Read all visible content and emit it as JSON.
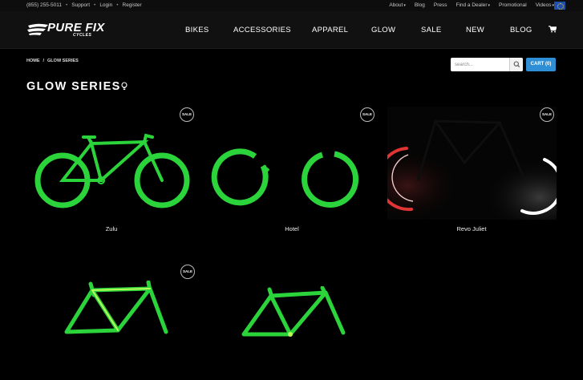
{
  "topbar": {
    "phone": "(855) 255-5011",
    "links": [
      "Support",
      "Login",
      "Register"
    ],
    "right_links": [
      {
        "label": "About",
        "dropdown": true
      },
      {
        "label": "Blog",
        "dropdown": false
      },
      {
        "label": "Press",
        "dropdown": false
      },
      {
        "label": "Find a Dealer",
        "dropdown": true
      },
      {
        "label": "Promotional",
        "dropdown": false
      },
      {
        "label": "Videos",
        "dropdown": true
      }
    ],
    "separator": "•",
    "caret": "▾"
  },
  "header": {
    "logo_text": "PURE FIX",
    "logo_sub": "CYCLES",
    "nav": [
      "BIKES",
      "ACCESSORIES",
      "APPAREL",
      "GLOW",
      "SALE",
      "NEW",
      "BLOG"
    ],
    "cart_icon": "cart-icon"
  },
  "breadcrumb": {
    "items": [
      "HOME",
      "GLOW SERIES"
    ],
    "separator": "/"
  },
  "search": {
    "placeholder": "search..."
  },
  "cart_button": "CART (0)",
  "page": {
    "title": "GLOW SERIES"
  },
  "colors": {
    "glow": "#2bd43a",
    "accent": "#2e8fd6",
    "background": "#000000"
  },
  "products": [
    {
      "name": "Zulu",
      "badge": "SALE"
    },
    {
      "name": "Hotel",
      "badge": "SALE"
    },
    {
      "name": "Revo Juliet",
      "badge": "SALE"
    },
    {
      "name": "",
      "badge": "SALE"
    },
    {
      "name": "",
      "badge": ""
    }
  ]
}
